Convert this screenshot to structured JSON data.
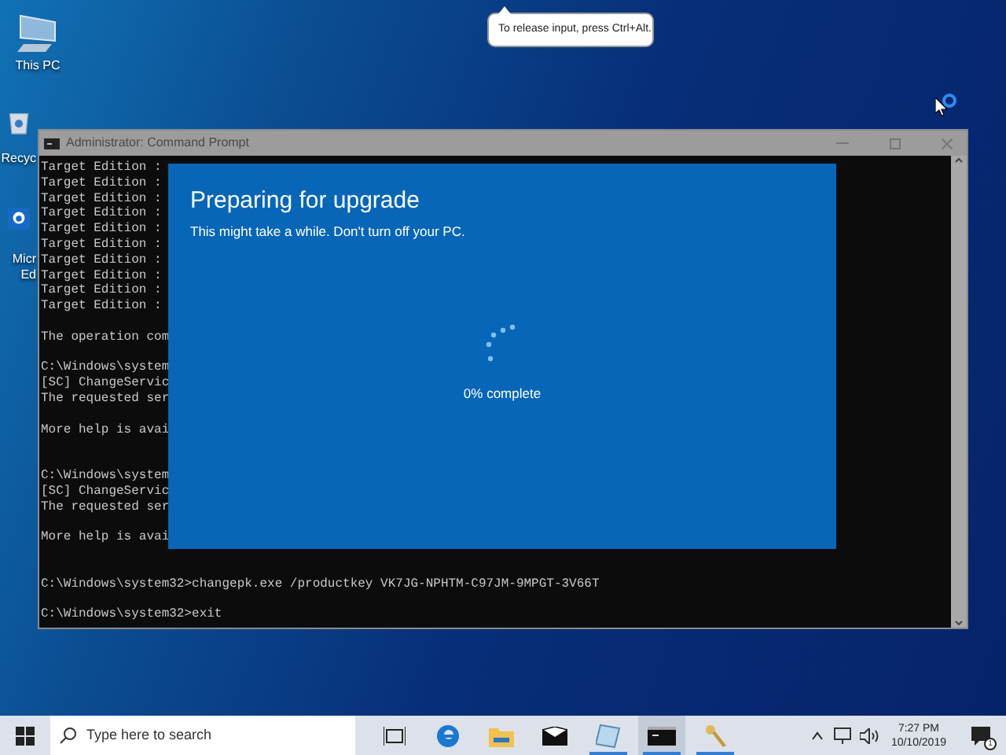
{
  "desktop_icons": [
    {
      "kind": "pc",
      "lines": [
        "This PC"
      ]
    },
    {
      "kind": "recycle",
      "lines": [
        "Recyc"
      ]
    },
    {
      "kind": "edge",
      "lines": [
        "Micr",
        "Ed"
      ]
    }
  ],
  "tooltip": {
    "text": "To release input, press Ctrl+Alt."
  },
  "console_window": {
    "title": "Administrator: Command Prompt",
    "lines": [
      {
        "kind": "text",
        "text": "Target Edition :"
      },
      {
        "kind": "text",
        "text": "Target Edition :"
      },
      {
        "kind": "text",
        "text": "Target Edition :"
      },
      {
        "kind": "text",
        "text": "Target Edition :"
      },
      {
        "kind": "text",
        "text": "Target Edition :"
      },
      {
        "kind": "text",
        "text": "Target Edition :"
      },
      {
        "kind": "text",
        "text": "Target Edition :"
      },
      {
        "kind": "text",
        "text": "Target Edition :"
      },
      {
        "kind": "text",
        "text": "Target Edition :"
      },
      {
        "kind": "text",
        "text": "Target Edition :"
      },
      {
        "kind": "blank"
      },
      {
        "kind": "text",
        "text": "The operation com"
      },
      {
        "kind": "blank"
      },
      {
        "kind": "text",
        "text": "C:\\Windows\\system"
      },
      {
        "kind": "text",
        "text": "[SC] ChangeServic"
      },
      {
        "kind": "text",
        "text": "The requested ser"
      },
      {
        "kind": "blank"
      },
      {
        "kind": "text",
        "text": "More help is avai"
      },
      {
        "kind": "blank"
      },
      {
        "kind": "blank"
      },
      {
        "kind": "text",
        "text": "C:\\Windows\\system"
      },
      {
        "kind": "text",
        "text": "[SC] ChangeServic"
      },
      {
        "kind": "text",
        "text": "The requested ser"
      },
      {
        "kind": "blank"
      },
      {
        "kind": "text",
        "text": "More help is avai"
      },
      {
        "kind": "blank"
      },
      {
        "kind": "blank"
      },
      {
        "kind": "text",
        "text": "C:\\Windows\\system32>changepk.exe /productkey VK7JG-NPHTM-C97JM-9MPGT-3V66T"
      },
      {
        "kind": "blank"
      },
      {
        "kind": "text",
        "text": "C:\\Windows\\system32>exit"
      }
    ]
  },
  "upgrade_dialog": {
    "title": "Preparing for upgrade",
    "subtitle": "This might take a while. Don't turn off your PC.",
    "progress": "0% complete"
  },
  "taskbar": {
    "search_placeholder": "Type here to search",
    "apps": [
      {
        "kind": "taskview",
        "running": false,
        "selected": false
      },
      {
        "kind": "edge",
        "running": false,
        "selected": false
      },
      {
        "kind": "explorer",
        "running": false,
        "selected": false
      },
      {
        "kind": "mail",
        "running": false,
        "selected": false
      },
      {
        "kind": "notepad",
        "running": true,
        "selected": false
      },
      {
        "kind": "cmd",
        "running": true,
        "selected": true
      },
      {
        "kind": "keys",
        "running": true,
        "selected": false
      }
    ],
    "time": "7:27 PM",
    "date": "10/10/2019",
    "notification_count": "1"
  }
}
